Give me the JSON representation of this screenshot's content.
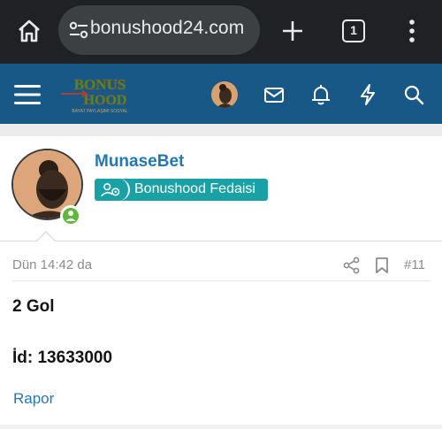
{
  "browser": {
    "url": "bonushood24.com",
    "tab_count": "1",
    "colors": {
      "bar_bg": "#202124",
      "pill_bg": "#3c4043",
      "text": "#e8eaed"
    },
    "icons": [
      "home-icon",
      "site-settings-icon",
      "new-tab-plus-icon",
      "tab-count-icon",
      "more-vertical-icon"
    ]
  },
  "header": {
    "logo_text": "BONUS HOOD",
    "logo_tagline": "BAYAT PAYLAŞIMI SOSYAL",
    "colors": {
      "bg": "#185886",
      "icon": "#ffffff"
    },
    "icons": [
      "hamburger-menu-icon",
      "user-avatar",
      "mail-icon",
      "bell-icon",
      "lightning-icon",
      "search-icon"
    ]
  },
  "profile": {
    "username": "MunaseBet",
    "badge_label": "Bonushood Fedaisi",
    "status": "online",
    "colors": {
      "username": "#2577b1",
      "badge_bg": "#1aa1a6",
      "online": "#5fb83b"
    }
  },
  "post": {
    "date": "Dün 14:42 da",
    "number": "#11",
    "body_line1": "2 Gol",
    "body_line2": "İd: 13633000",
    "report_label": "Rapor",
    "icons": [
      "share-icon",
      "bookmark-icon"
    ]
  }
}
